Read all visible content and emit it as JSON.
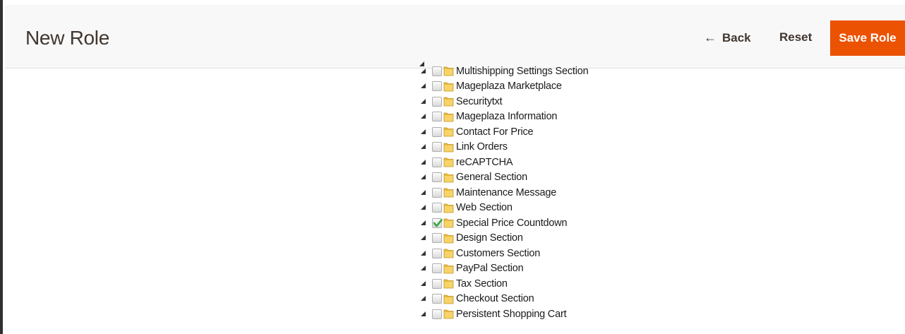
{
  "header": {
    "title": "New Role",
    "back_label": "Back",
    "reset_label": "Reset",
    "save_label": "Save Role"
  },
  "tree": {
    "items": [
      {
        "label": "Multishipping Settings Section",
        "checked": false
      },
      {
        "label": "Mageplaza Marketplace",
        "checked": false
      },
      {
        "label": "Securitytxt",
        "checked": false
      },
      {
        "label": "Mageplaza Information",
        "checked": false
      },
      {
        "label": "Contact For Price",
        "checked": false
      },
      {
        "label": "Link Orders",
        "checked": false
      },
      {
        "label": "reCAPTCHA",
        "checked": false
      },
      {
        "label": "General Section",
        "checked": false
      },
      {
        "label": "Maintenance Message",
        "checked": false
      },
      {
        "label": "Web Section",
        "checked": false
      },
      {
        "label": "Special Price Countdown",
        "checked": true
      },
      {
        "label": "Design Section",
        "checked": false
      },
      {
        "label": "Customers Section",
        "checked": false
      },
      {
        "label": "PayPal Section",
        "checked": false
      },
      {
        "label": "Tax Section",
        "checked": false
      },
      {
        "label": "Checkout Section",
        "checked": false
      },
      {
        "label": "Persistent Shopping Cart",
        "checked": false
      }
    ]
  },
  "colors": {
    "accent": "#eb5202",
    "title_text": "#41362f",
    "check_green": "#3aa83a",
    "folder": "#f0c040"
  },
  "icons": {
    "back": "arrow-left-icon",
    "toggle": "triangle-expanded-icon",
    "folder": "folder-icon",
    "checked": "checkmark-icon"
  }
}
